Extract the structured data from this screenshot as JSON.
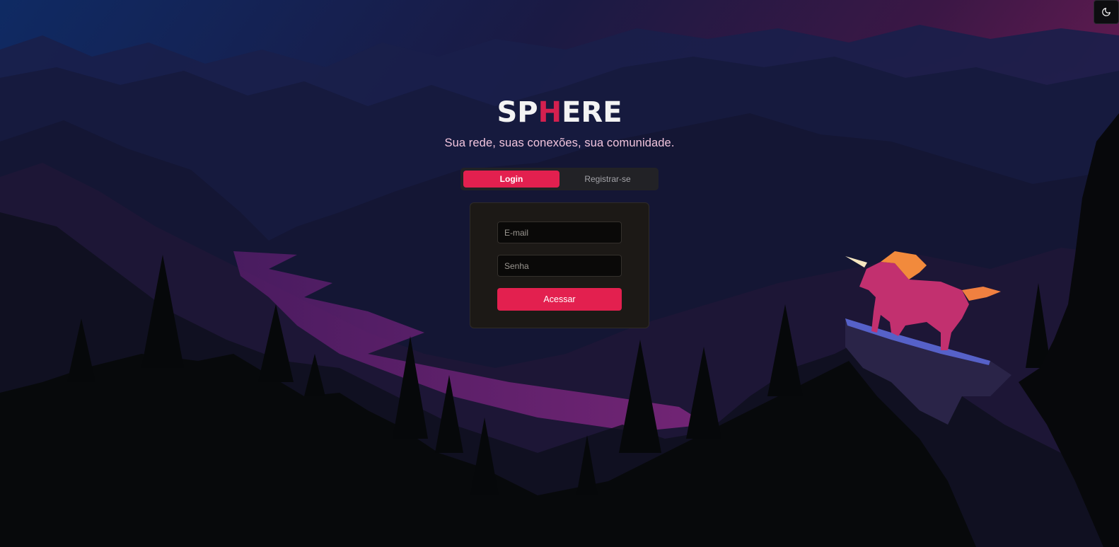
{
  "theme_toggle": {
    "icon": "moon-icon"
  },
  "brand": {
    "logo_part1": "SP",
    "logo_accent": "H",
    "logo_part2": "ERE",
    "accent_color": "#d4204f",
    "tagline": "Sua rede, suas conexões, sua comunidade."
  },
  "tabs": [
    {
      "label": "Login",
      "active": true
    },
    {
      "label": "Registrar-se",
      "active": false
    }
  ],
  "form": {
    "email_placeholder": "E-mail",
    "email_value": "",
    "password_placeholder": "Senha",
    "password_value": "",
    "submit_label": "Acessar"
  },
  "colors": {
    "primary": "#e3204f",
    "card_bg": "#1c1916",
    "tab_bar_bg": "#222226"
  },
  "background": {
    "scene": "unicorn-on-cliff-mountain-landscape"
  }
}
